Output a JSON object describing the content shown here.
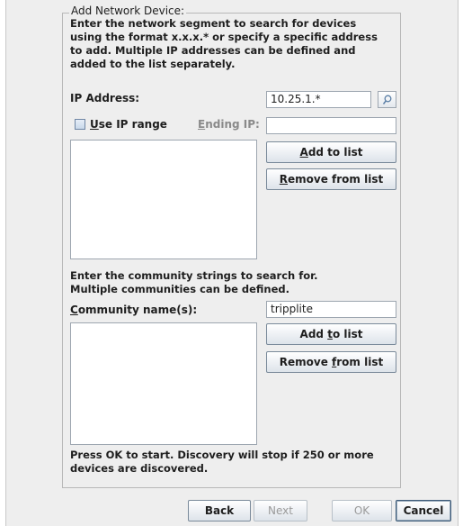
{
  "group": {
    "legend": "Add Network Device:"
  },
  "intro_text": "Enter the network segment to search for devices\nusing the format x.x.x.* or specify a specific address\nto add. Multiple IP addresses can be defined and\nadded to the list separately.",
  "ip": {
    "label": "IP Address:",
    "value": "10.25.1.*",
    "search_icon": "search-icon"
  },
  "range": {
    "checkbox_label": "Use IP range",
    "checkbox_checked": false,
    "ending_label": "Ending IP:",
    "ending_value": ""
  },
  "ip_list": {
    "add_label": "Add to list",
    "remove_label": "Remove from list",
    "items": []
  },
  "community_text": "Enter the community strings to search for.\nMultiple communities can be defined.",
  "community": {
    "label": "Community name(s):",
    "value": "tripplite",
    "add_label": "Add to list",
    "remove_label": "Remove from list",
    "items": []
  },
  "footer_text": "Press OK to start. Discovery will stop if 250 or more\ndevices are discovered.",
  "buttons": {
    "back": "Back",
    "next": "Next",
    "ok": "OK",
    "cancel": "Cancel"
  }
}
